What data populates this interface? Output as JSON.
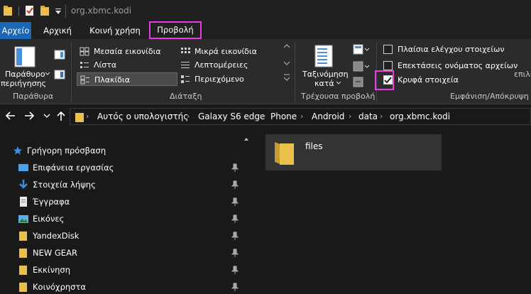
{
  "window": {
    "title": "org.xbmc.kodi"
  },
  "tabs": {
    "file": "Αρχείο",
    "home": "Αρχική",
    "share": "Κοινή χρήση",
    "view": "Προβολή"
  },
  "ribbon": {
    "panes": {
      "preview_line1": "Παράθυρο",
      "preview_line2": "περιήγησης",
      "group": "Παράθυρα"
    },
    "layout": {
      "group": "Διάταξη",
      "items": [
        "Μεσαία εικονίδια",
        "Μικρά εικονίδια",
        "Λίστα",
        "Λεπτομέρειες",
        "Πλακίδια",
        "Περιεχόμενο"
      ],
      "selected": "Πλακίδια"
    },
    "current_view": {
      "sort_line1": "Ταξινόμηση",
      "sort_line2": "κατά",
      "group": "Τρέχουσα προβολή"
    },
    "show_hide": {
      "group": "Εμφάνιση/Απόκρυψη",
      "item_checkboxes": {
        "label": "Πλαίσια ελέγχου στοιχείων",
        "checked": false
      },
      "file_extensions": {
        "label": "Επεκτάσεις ονόματος αρχείων",
        "checked": false
      },
      "hidden_items": {
        "label": "Κρυφά στοιχεία",
        "checked": true
      },
      "hide_selected": "επιλε"
    }
  },
  "address": {
    "crumbs": [
      "Αυτός ο υπολογιστής",
      "Galaxy S6 edge",
      "Phone",
      "Android",
      "data",
      "org.xbmc.kodi"
    ]
  },
  "nav": {
    "quick_access": "Γρήγορη πρόσβαση",
    "items": [
      {
        "label": "Επιφάνεια εργασίας",
        "icon": "desktop-icon"
      },
      {
        "label": "Στοιχεία λήψης",
        "icon": "download-icon"
      },
      {
        "label": "Έγγραφα",
        "icon": "documents-icon"
      },
      {
        "label": "Εικόνες",
        "icon": "pictures-icon"
      },
      {
        "label": "YandexDisk",
        "icon": "folder-icon"
      },
      {
        "label": "NEW GEAR",
        "icon": "folder-icon"
      },
      {
        "label": "Εκκίνηση",
        "icon": "folder-icon"
      },
      {
        "label": "Κοινόχρηστα",
        "icon": "folder-icon"
      }
    ]
  },
  "content": {
    "items": [
      {
        "name": "files",
        "icon": "folder-icon"
      }
    ]
  },
  "colors": {
    "accent": "#1a67b8",
    "highlight": "#e73ce3",
    "folder": "#e8c04a",
    "background": "#191919"
  }
}
